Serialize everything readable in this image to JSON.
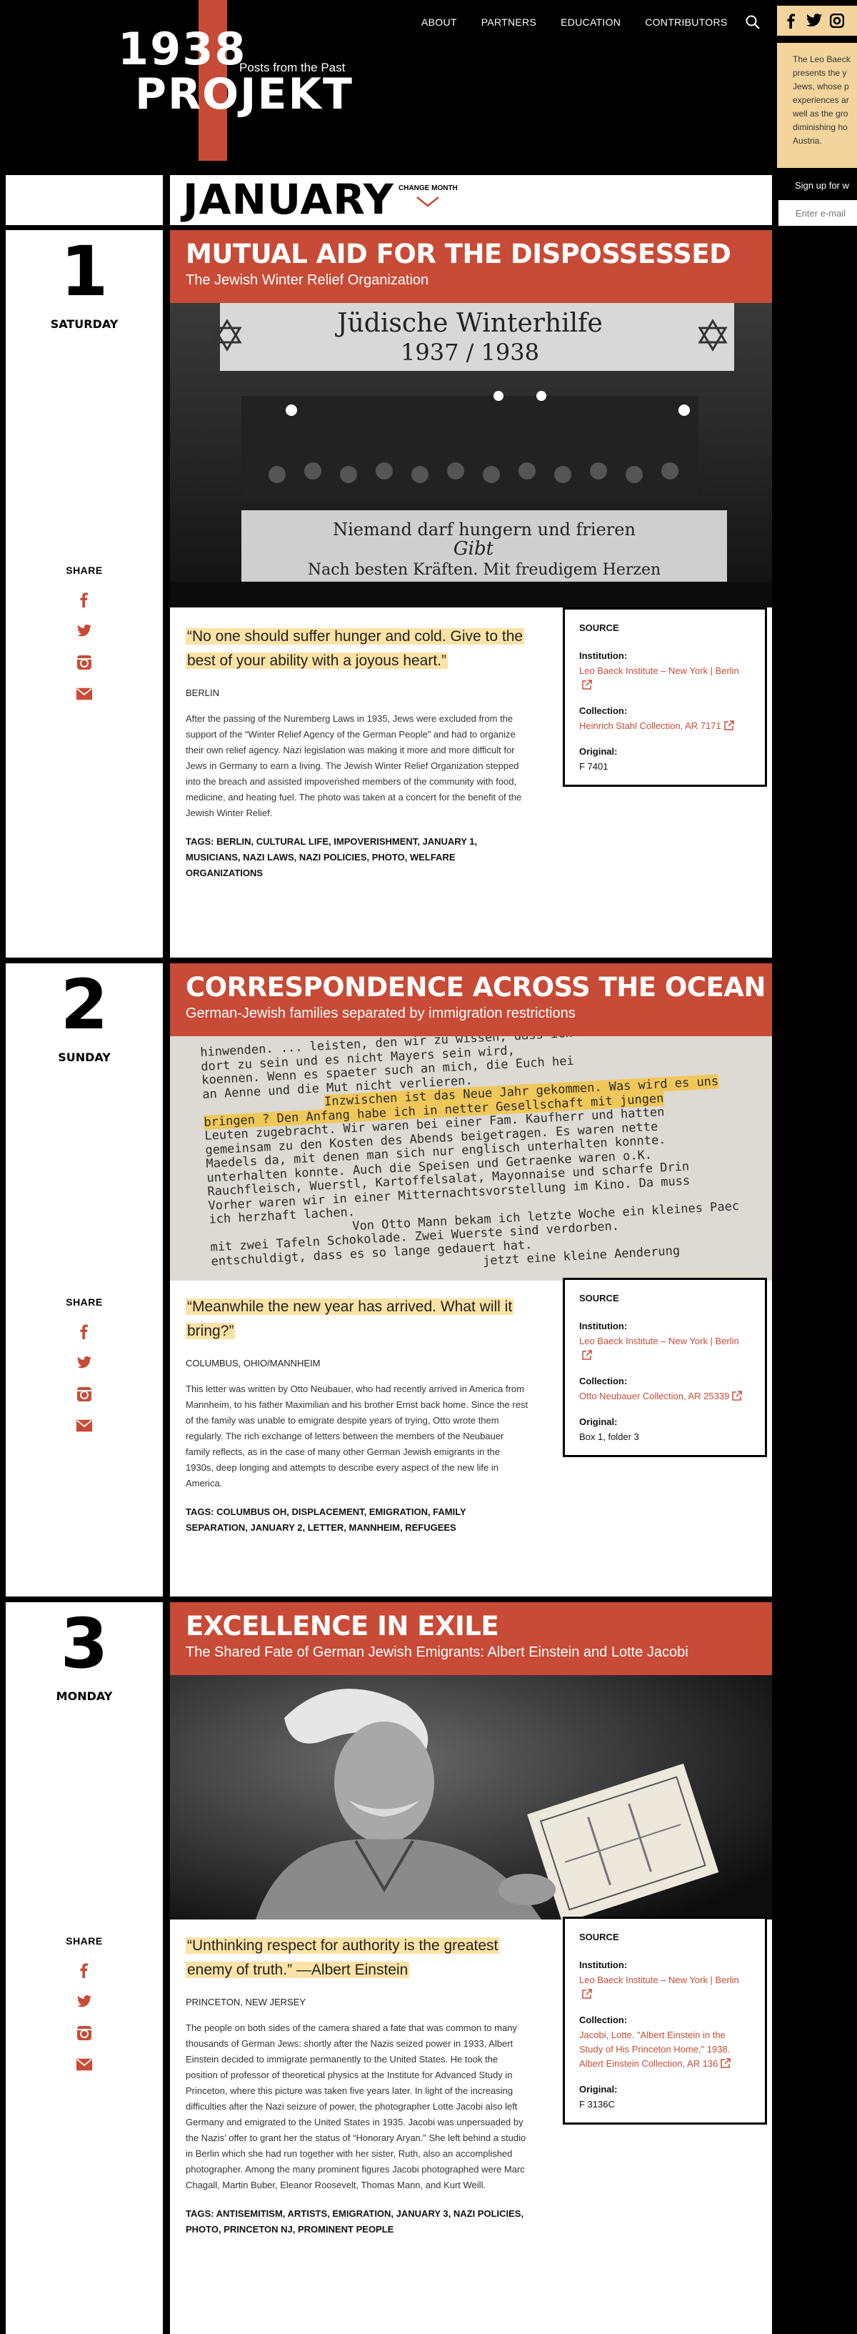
{
  "header": {
    "logo_year": "1938",
    "logo_word": "PROJEKT",
    "logo_tagline": "Posts from the Past",
    "nav": [
      "ABOUT",
      "PARTNERS",
      "EDUCATION",
      "CONTRIBUTORS"
    ],
    "promo_lines": [
      "The Leo Baeck",
      "presents the y",
      "Jews, whose p",
      "experiences ar",
      "well as the gro",
      "diminishing ho",
      "Austria."
    ],
    "signup_label": "Sign up for w",
    "signup_placeholder": "Enter e-mail"
  },
  "month": {
    "title": "JANUARY",
    "change_label": "CHANGE MONTH"
  },
  "share_label": "SHARE",
  "entries": [
    {
      "day": "1",
      "weekday": "SATURDAY",
      "title": "MUTUAL AID FOR THE DISPOSSESSED",
      "subtitle": "The Jewish Winter Relief Organization",
      "photo_banner_top": "Jüdische   Winterhilfe",
      "photo_banner_years": "1937 / 1938",
      "photo_banner_mid": "Niemand darf hungern und frieren",
      "photo_banner_gibt": "Gibt",
      "photo_banner_bottom": "Nach besten Kräften. Mit freudigem Herzen",
      "quote": "“No one should suffer hunger and cold. Give to the best of your ability with a joyous heart.”",
      "place": "BERLIN",
      "description": "After the passing of the Nuremberg Laws in 1935, Jews were excluded from the support of the “Winter Relief Agency of the German People” and had to organize their own relief agency. Nazi legislation was making it more and more difficult for Jews in Germany to earn a living. The Jewish Winter Relief Organization stepped into the breach and assisted impoverished members of the community with food, medicine, and heating fuel. The photo was taken at a concert for the benefit of the Jewish Winter Relief.",
      "tags": "TAGS: BERLIN, CULTURAL LIFE, IMPOVERISHMENT, JANUARY 1, MUSICIANS, NAZI LAWS, NAZI POLICIES, PHOTO, WELFARE ORGANIZATIONS",
      "source": {
        "heading": "SOURCE",
        "institution_label": "Institution:",
        "institution": "Leo Baeck Institute – New York | Berlin",
        "collection_label": "Collection:",
        "collection": "Heinrich Stahl Collection, AR 7171",
        "original_label": "Original:",
        "original": "F 7401"
      }
    },
    {
      "day": "2",
      "weekday": "SUNDAY",
      "title": "CORRESPONDENCE ACROSS THE OCEAN",
      "subtitle": "German-Jewish families separated by immigration restrictions",
      "photo_lines": [
        "hinwenden. ... leisten, den wir zu wissen, dass ich Euch helf",
        "dort zu sein und es nicht Mayers sein wird,",
        "koennen. Wenn es spaeter such an mich, die Euch hei",
        "an Aenne und die Mut nicht verlieren.",
        "Inzwischen ist das Neue Jahr gekommen. Was wird es uns",
        "bringen ? Den Anfang habe ich in netter Gesellschaft mit jungen",
        "Leuten zugebracht. Wir waren bei einer Fam. Kaufherr und hatten",
        "gemeinsam zu den Kosten des Abends beigetragen. Es waren nette",
        "Maedels da, mit denen man sich nur englisch unterhalten konnte.",
        "unterhalten konnte. Auch die Speisen und Getraenke waren o.K.",
        "Rauchfleisch, Wuerstl, Kartoffelsalat, Mayonnaise und scharfe Drin",
        "Vorher waren wir in einer Mitternachtsvorstellung im Kino. Da muss",
        "ich herzhaft lachen.",
        "Von Otto Mann bekam ich letzte Woche ein kleines Paec",
        "mit zwei Tafeln Schokolade. Zwei Wuerste sind verdorben.",
        "entschuldigt, dass es so lange gedauert hat.",
        "jetzt eine kleine Aenderung"
      ],
      "quote": "“Meanwhile the new year has arrived. What will it bring?”",
      "place": "COLUMBUS, OHIO/MANNHEIM",
      "description": "This letter was written by Otto Neubauer, who had recently arrived in America from Mannheim, to his father Maximilian and his brother Ernst back home. Since the rest of the family was unable to emigrate despite years of trying, Otto wrote them regularly. The rich exchange of letters between the members of the Neubauer family reflects, as in the case of many other German Jewish emigrants in the 1930s, deep longing and attempts to describe every aspect of the new life in America.",
      "tags": "TAGS: COLUMBUS OH, DISPLACEMENT, EMIGRATION, FAMILY SEPARATION, JANUARY 2, LETTER, MANNHEIM, REFUGEES",
      "source": {
        "heading": "SOURCE",
        "institution_label": "Institution:",
        "institution": "Leo Baeck Institute – New York | Berlin",
        "collection_label": "Collection:",
        "collection": "Otto Neubauer Collection, AR 25339",
        "original_label": "Original:",
        "original": "Box 1, folder 3"
      }
    },
    {
      "day": "3",
      "weekday": "MONDAY",
      "title": "EXCELLENCE IN EXILE",
      "subtitle": "The Shared Fate of German Jewish Emigrants: Albert Einstein and Lotte Jacobi",
      "quote": "“Unthinking respect for authority is the greatest enemy of truth.” —Albert Einstein",
      "place": "PRINCETON, NEW JERSEY",
      "description": "The people on both sides of the camera shared a fate that was common to many thousands of German Jews: shortly after the Nazis seized power in 1933, Albert Einstein decided to immigrate permanently to the United States. He took the position of professor of theoretical physics at the Institute for Advanced Study in Princeton, where this picture was taken five years later. In light of the increasing difficulties after the Nazi seizure of power, the photographer Lotte Jacobi also left Germany and emigrated to the United States in 1935. Jacobi was unpersuaded by the Nazis’ offer to grant her the status of “Honorary Aryan.” She left behind a studio in Berlin which she had run together with her sister, Ruth, also an accomplished photographer. Among the many prominent figures Jacobi photographed were Marc Chagall, Martin Buber, Eleanor Roosevelt, Thomas Mann, and Kurt Weill.",
      "tags": "TAGS: ANTISEMITISM, ARTISTS, EMIGRATION, JANUARY 3, NAZI POLICIES, PHOTO, PRINCETON NJ, PROMINENT PEOPLE",
      "source": {
        "heading": "SOURCE",
        "institution_label": "Institution:",
        "institution": "Leo Baeck Institute – New York | Berlin",
        "collection_label": "Collection:",
        "collection": "Jacobi, Lotte. \"Albert Einstein in the Study of His Princeton Home,\" 1938. Albert Einstein Collection, AR 136",
        "original_label": "Original:",
        "original": "F 3136C"
      }
    }
  ],
  "colors": {
    "accent": "#c74b36",
    "highlight": "#fbe2a6",
    "promo_bg": "#f2d49c"
  }
}
